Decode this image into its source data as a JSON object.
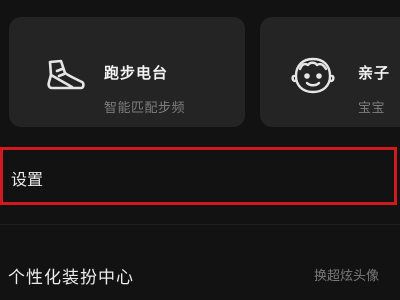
{
  "cards": [
    {
      "title": "跑步电台",
      "subtitle": "智能匹配步频",
      "icon": "running-shoe-icon"
    },
    {
      "title": "亲子",
      "subtitle": "宝宝",
      "icon": "child-face-icon"
    }
  ],
  "settings": {
    "label": "设置",
    "highlight_color": "#d11922"
  },
  "personalization": {
    "label": "个性化装扮中心",
    "description": "换超炫头像"
  }
}
